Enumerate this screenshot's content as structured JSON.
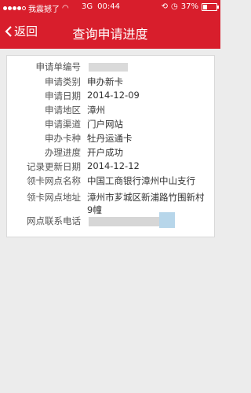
{
  "status": {
    "carrier": "我震撼了",
    "network": "3G",
    "time": "00:44",
    "battery": "37%",
    "battery_level": 0.37
  },
  "nav": {
    "back_label": "返回",
    "title": "查询申请进度"
  },
  "details": [
    {
      "label": "申请单编号",
      "value": ""
    },
    {
      "label": "申请类别",
      "value": "申办新卡"
    },
    {
      "label": "申请日期",
      "value": "2014-12-09"
    },
    {
      "label": "申请地区",
      "value": "漳州"
    },
    {
      "label": "申请渠道",
      "value": "门户网站"
    },
    {
      "label": "申办卡种",
      "value": "牡丹运通卡"
    },
    {
      "label": "办理进度",
      "value": "开户成功"
    },
    {
      "label": "记录更新日期",
      "value": "2014-12-12"
    },
    {
      "label": "领卡网点名称",
      "value": "中国工商银行漳州中山支行"
    },
    {
      "label": "领卡网点地址",
      "value": "漳州市芗城区新浦路竹围新村9幢"
    },
    {
      "label": "网点联系电话",
      "value": ""
    }
  ],
  "colors": {
    "brand": "#d81e2c"
  }
}
